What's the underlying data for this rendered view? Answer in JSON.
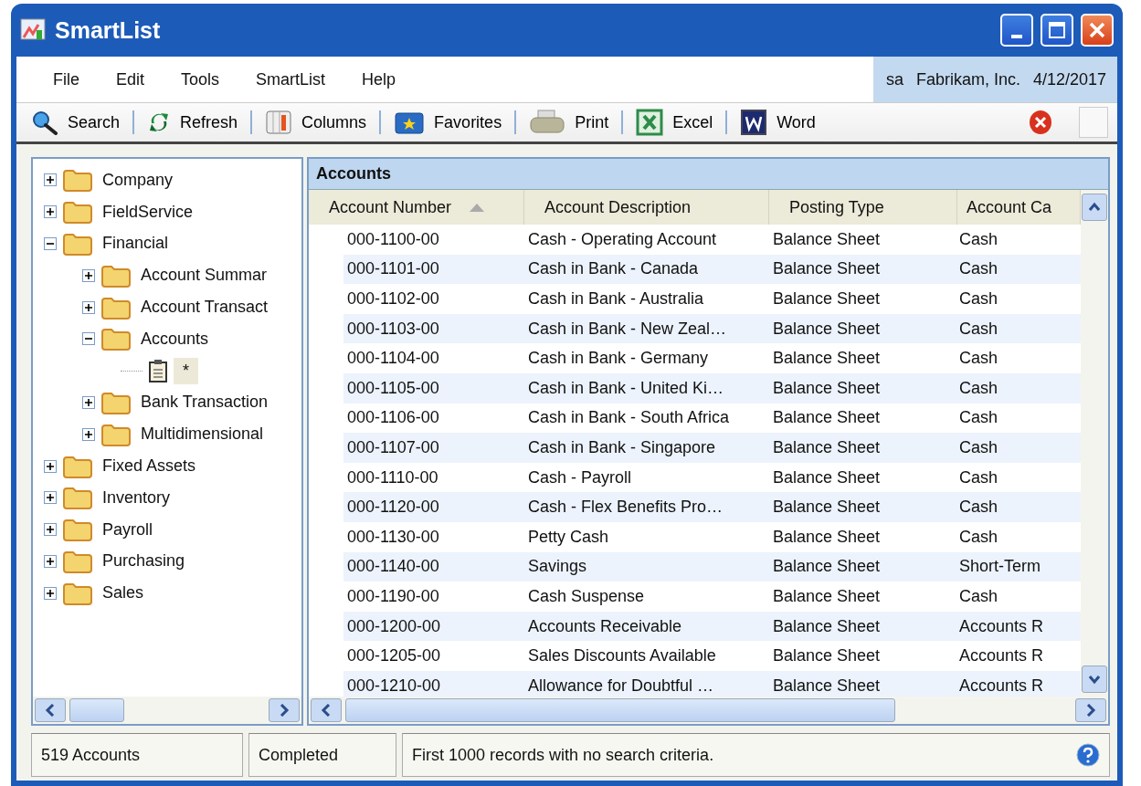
{
  "window": {
    "title": "SmartList"
  },
  "menu": {
    "items": [
      "File",
      "Edit",
      "Tools",
      "SmartList",
      "Help"
    ],
    "user": "sa",
    "company": "Fabrikam, Inc.",
    "date": "4/12/2017"
  },
  "toolbar": [
    {
      "kind": "search",
      "label": "Search"
    },
    {
      "kind": "refresh",
      "label": "Refresh"
    },
    {
      "kind": "columns",
      "label": "Columns"
    },
    {
      "kind": "favorites",
      "label": "Favorites"
    },
    {
      "kind": "print",
      "label": "Print"
    },
    {
      "kind": "excel",
      "label": "Excel"
    },
    {
      "kind": "word",
      "label": "Word"
    }
  ],
  "tree": [
    {
      "kind": "folder",
      "label": "Company",
      "expanded": false,
      "selected": false
    },
    {
      "kind": "folder",
      "label": "FieldService",
      "expanded": false,
      "selected": false
    },
    {
      "kind": "folder",
      "label": "Financial",
      "expanded": true,
      "selected": false,
      "children": [
        {
          "kind": "folder",
          "label": "Account Summar",
          "expanded": false,
          "selected": false
        },
        {
          "kind": "folder",
          "label": "Account Transact",
          "expanded": false,
          "selected": false
        },
        {
          "kind": "folder",
          "label": "Accounts",
          "expanded": true,
          "selected": false,
          "children": [
            {
              "kind": "list",
              "label": "*",
              "selected": true
            }
          ]
        },
        {
          "kind": "folder",
          "label": "Bank Transaction",
          "expanded": false,
          "selected": false
        },
        {
          "kind": "folder",
          "label": "Multidimensional",
          "expanded": false,
          "selected": false
        }
      ]
    },
    {
      "kind": "folder",
      "label": "Fixed Assets",
      "expanded": false,
      "selected": false
    },
    {
      "kind": "folder",
      "label": "Inventory",
      "expanded": false,
      "selected": false
    },
    {
      "kind": "folder",
      "label": "Payroll",
      "expanded": false,
      "selected": false
    },
    {
      "kind": "folder",
      "label": "Purchasing",
      "expanded": false,
      "selected": false
    },
    {
      "kind": "folder",
      "label": "Sales",
      "expanded": false,
      "selected": false
    }
  ],
  "grid": {
    "title": "Accounts",
    "columns": [
      {
        "label": "Account Number",
        "sorted": true
      },
      {
        "label": "Account Description",
        "sorted": false
      },
      {
        "label": "Posting Type",
        "sorted": false
      },
      {
        "label": "Account Ca",
        "sorted": false
      }
    ],
    "rows": [
      [
        "000-1100-00",
        "Cash - Operating Account",
        "Balance Sheet",
        "Cash"
      ],
      [
        "000-1101-00",
        "Cash in Bank - Canada",
        "Balance Sheet",
        "Cash"
      ],
      [
        "000-1102-00",
        "Cash in Bank - Australia",
        "Balance Sheet",
        "Cash"
      ],
      [
        "000-1103-00",
        "Cash in Bank - New Zeal…",
        "Balance Sheet",
        "Cash"
      ],
      [
        "000-1104-00",
        "Cash in Bank - Germany",
        "Balance Sheet",
        "Cash"
      ],
      [
        "000-1105-00",
        "Cash in Bank - United Ki…",
        "Balance Sheet",
        "Cash"
      ],
      [
        "000-1106-00",
        "Cash in Bank - South Africa",
        "Balance Sheet",
        "Cash"
      ],
      [
        "000-1107-00",
        "Cash in Bank - Singapore",
        "Balance Sheet",
        "Cash"
      ],
      [
        "000-1110-00",
        "Cash - Payroll",
        "Balance Sheet",
        "Cash"
      ],
      [
        "000-1120-00",
        "Cash - Flex Benefits Pro…",
        "Balance Sheet",
        "Cash"
      ],
      [
        "000-1130-00",
        "Petty Cash",
        "Balance Sheet",
        "Cash"
      ],
      [
        "000-1140-00",
        "Savings",
        "Balance Sheet",
        "Short-Term"
      ],
      [
        "000-1190-00",
        "Cash Suspense",
        "Balance Sheet",
        "Cash"
      ],
      [
        "000-1200-00",
        "Accounts Receivable",
        "Balance Sheet",
        "Accounts R"
      ],
      [
        "000-1205-00",
        "Sales Discounts Available",
        "Balance Sheet",
        "Accounts R"
      ],
      [
        "000-1210-00",
        "Allowance for Doubtful …",
        "Balance Sheet",
        "Accounts R"
      ]
    ]
  },
  "status_bar": {
    "count": "519 Accounts",
    "state": "Completed",
    "message": "First 1000 records with no search criteria."
  }
}
